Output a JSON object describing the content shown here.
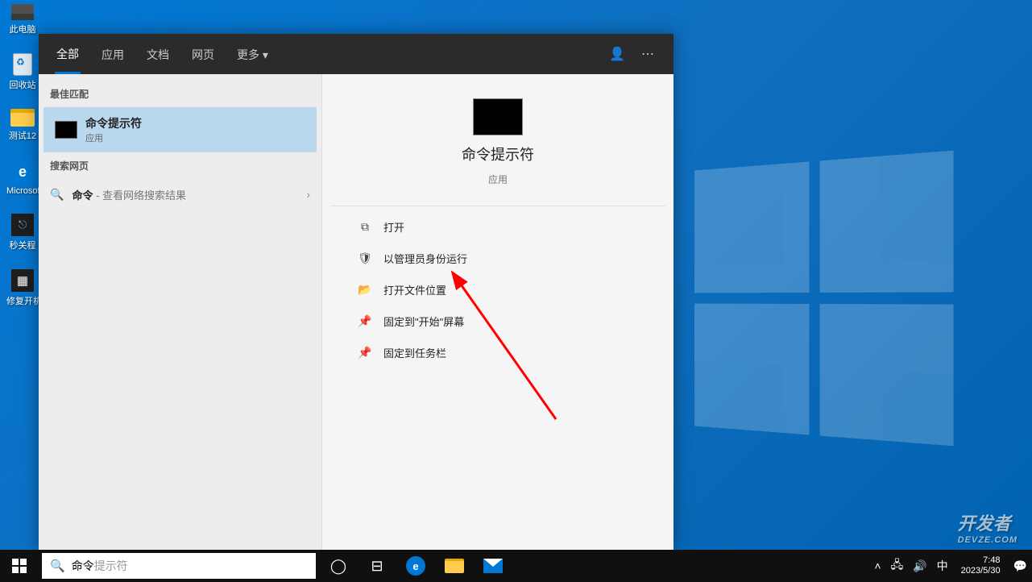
{
  "desktop": {
    "icons": [
      {
        "name": "此电脑",
        "kind": "pc"
      },
      {
        "name": "回收站",
        "kind": "recycle"
      },
      {
        "name": "测试12",
        "kind": "folder"
      },
      {
        "name": "Microsoft Edge",
        "kind": "edge"
      },
      {
        "name": "秒关程",
        "kind": "tool"
      },
      {
        "name": "修复开机屏",
        "kind": "tool2"
      }
    ]
  },
  "search": {
    "tabs": [
      "全部",
      "应用",
      "文档",
      "网页",
      "更多"
    ],
    "active_tab": "全部",
    "left": {
      "best_label": "最佳匹配",
      "best_match": {
        "title": "命令提示符",
        "subtitle": "应用"
      },
      "web_label": "搜索网页",
      "web_row": {
        "term": "命令",
        "desc": " - 查看网络搜索结果"
      }
    },
    "right": {
      "title": "命令提示符",
      "subtitle": "应用",
      "actions": [
        {
          "icon": "⧉",
          "label": "打开"
        },
        {
          "icon": "🛡",
          "label": "以管理员身份运行"
        },
        {
          "icon": "📂",
          "label": "打开文件位置"
        },
        {
          "icon": "📌",
          "label": "固定到\"开始\"屏幕"
        },
        {
          "icon": "📌",
          "label": "固定到任务栏"
        }
      ]
    }
  },
  "taskbar": {
    "search_typed": "命令",
    "search_hint": "提示符",
    "ime": "中",
    "time": "7:48",
    "date": "2023/5/30"
  },
  "watermark": {
    "line1": "开发者",
    "line2": "DEVZE.COM"
  }
}
